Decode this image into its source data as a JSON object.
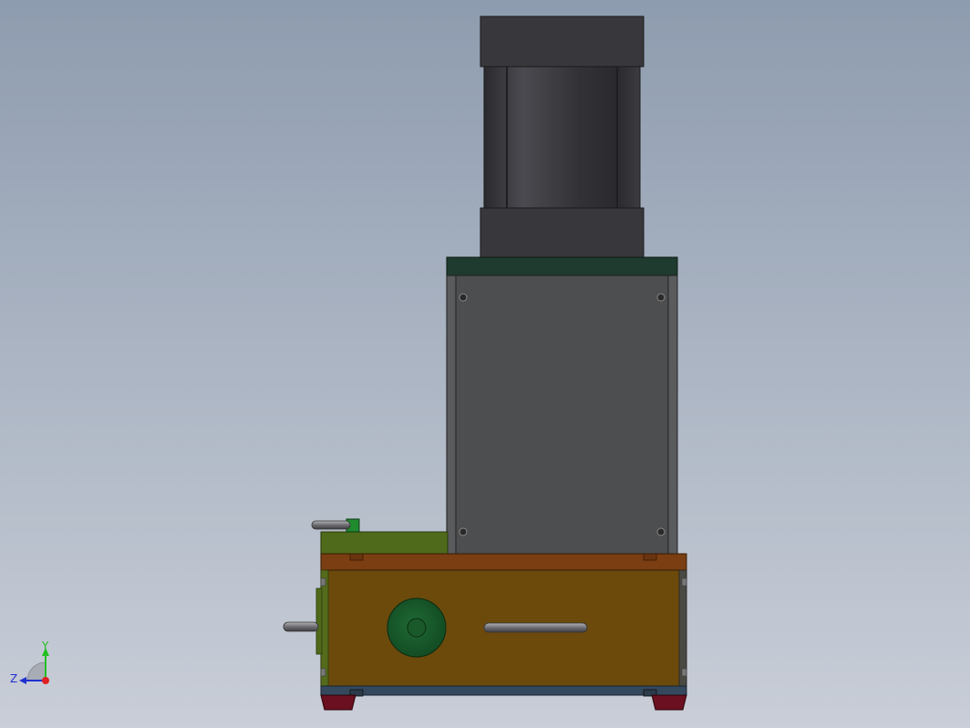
{
  "viewport": {
    "background_top": "#8E9CAF",
    "background_bottom": "#C8CDD7"
  },
  "colors": {
    "motor_dark": "#2F2F33",
    "motor_mid": "#4A4A4F",
    "motor_cap": "#3A3A3E",
    "housing_gray": "#4E4F51",
    "housing_top": "#1E3A2E",
    "base_brown": "#6B4A0C",
    "base_plate": "#7A3E12",
    "side_green": "#4F6A1A",
    "knob_green": "#1F5A2E",
    "foot_red": "#6A1020",
    "handle_metal": "#7D7D80"
  },
  "triad": {
    "x_label": "",
    "y_label": "Y",
    "z_label": "Z",
    "y_color": "#22C022",
    "z_color": "#2030D0",
    "origin_color": "#E02020"
  }
}
